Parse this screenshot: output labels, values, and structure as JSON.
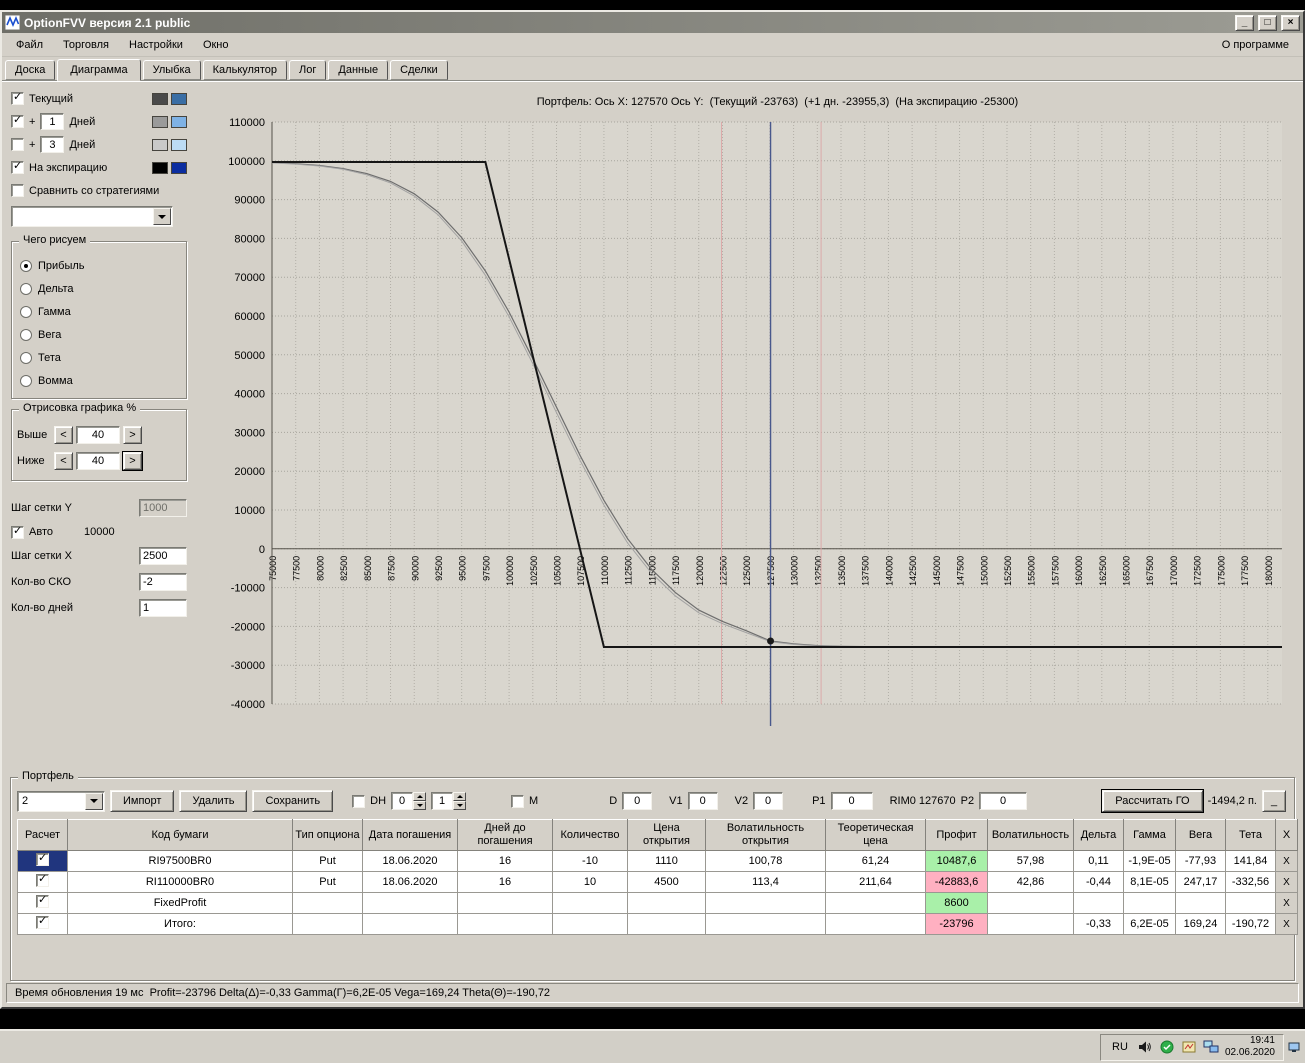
{
  "window": {
    "title": "OptionFVV версия 2.1 public",
    "minimize_glyph": "_",
    "maximize_glyph": "□",
    "close_glyph": "×"
  },
  "menu": {
    "items": [
      "Файл",
      "Торговля",
      "Настройки",
      "Окно"
    ],
    "right_item": "О программе"
  },
  "tabs": {
    "items": [
      "Доска",
      "Диаграмма",
      "Улыбка",
      "Калькулятор",
      "Лог",
      "Данные",
      "Сделки"
    ],
    "active": "Диаграмма"
  },
  "sidebar": {
    "series": [
      {
        "label": "Текущий",
        "checked": true,
        "colors": [
          "#4a4a4a",
          "#3a6ea5"
        ]
      },
      {
        "prefix": "+",
        "days": "1",
        "label": "Дней",
        "checked": true,
        "colors": [
          "#9a9a9a",
          "#7fb2e5"
        ]
      },
      {
        "prefix": "+",
        "days": "3",
        "label": "Дней",
        "checked": false,
        "colors": [
          "#c9c9c9",
          "#bcdcf5"
        ]
      },
      {
        "label": "На экспирацию",
        "checked": true,
        "colors": [
          "#000000",
          "#0b2da0"
        ]
      }
    ],
    "compare_label": "Сравнить со стратегиями",
    "compare_checked": false,
    "strategy_value": "",
    "draw_group": {
      "title": "Чего рисуем",
      "options": [
        "Прибыль",
        "Дельта",
        "Гамма",
        "Вега",
        "Тета",
        "Вомма"
      ],
      "selected": "Прибыль"
    },
    "render_group": {
      "title": "Отрисовка графика %",
      "dec_label": "<",
      "inc_label": ">",
      "rows": [
        {
          "label": "Выше",
          "value": "40",
          "focused": false
        },
        {
          "label": "Ниже",
          "value": "40",
          "focused": true
        }
      ]
    },
    "grid": {
      "step_y_label": "Шаг сетки Y",
      "step_y_value": "1000",
      "auto_label": "Авто",
      "auto_checked": true,
      "auto_value": "10000",
      "step_x_label": "Шаг сетки X",
      "step_x_value": "2500",
      "sko_label": "Кол-во СКО",
      "sko_value": "-2",
      "days_label": "Кол-во дней",
      "days_value": "1"
    }
  },
  "chart_data": {
    "type": "line",
    "title": "Портфель: Ось X: 127570 Ось Y:  (Текущий -23763)  (+1 дн. -23955,3)  (На экспирацию -25300)",
    "x_axis": {
      "min": 75000,
      "max": 181500,
      "tick_min": 75000,
      "tick_max": 180000,
      "tick_step": 2500
    },
    "y_axis": {
      "min": -40000,
      "max": 110000,
      "tick_step": 10000
    },
    "grid": true,
    "series": [
      {
        "id": "current",
        "name": "Текущий",
        "color": "#6e6e6e",
        "width": 1.2,
        "points": [
          [
            75000,
            99500
          ],
          [
            77500,
            99250
          ],
          [
            80000,
            98800
          ],
          [
            82500,
            98000
          ],
          [
            85000,
            96700
          ],
          [
            87500,
            94700
          ],
          [
            90000,
            91500
          ],
          [
            92500,
            86800
          ],
          [
            95000,
            80200
          ],
          [
            97500,
            71600
          ],
          [
            100000,
            61000
          ],
          [
            102500,
            49000
          ],
          [
            105000,
            36500
          ],
          [
            107500,
            24000
          ],
          [
            110000,
            12500
          ],
          [
            112500,
            2600
          ],
          [
            115000,
            -5200
          ],
          [
            117500,
            -11200
          ],
          [
            120000,
            -15800
          ],
          [
            122500,
            -18700
          ],
          [
            125000,
            -21100
          ],
          [
            127570,
            -23763
          ],
          [
            130000,
            -24500
          ],
          [
            132500,
            -24950
          ],
          [
            135000,
            -25130
          ],
          [
            140000,
            -25260
          ],
          [
            145000,
            -25300
          ],
          [
            181500,
            -25300
          ]
        ]
      },
      {
        "id": "plus-1-day",
        "name": "+1 Дней",
        "color": "#a3a3a3",
        "width": 1,
        "points": [
          [
            75000,
            99450
          ],
          [
            77500,
            99150
          ],
          [
            80000,
            98650
          ],
          [
            82500,
            97800
          ],
          [
            85000,
            96400
          ],
          [
            87500,
            94300
          ],
          [
            90000,
            90900
          ],
          [
            92500,
            86100
          ],
          [
            95000,
            79300
          ],
          [
            97500,
            70500
          ],
          [
            100000,
            59800
          ],
          [
            102500,
            47700
          ],
          [
            105000,
            35100
          ],
          [
            107500,
            22700
          ],
          [
            110000,
            11300
          ],
          [
            112500,
            1500
          ],
          [
            115000,
            -6200
          ],
          [
            117500,
            -12100
          ],
          [
            120000,
            -16500
          ],
          [
            122500,
            -19300
          ],
          [
            125000,
            -21600
          ],
          [
            127570,
            -23955
          ],
          [
            130000,
            -24650
          ],
          [
            132500,
            -25050
          ],
          [
            135000,
            -25180
          ],
          [
            140000,
            -25280
          ],
          [
            145000,
            -25300
          ],
          [
            181500,
            -25300
          ]
        ]
      },
      {
        "id": "expiration",
        "name": "На экспирацию",
        "color": "#161616",
        "width": 2,
        "points": [
          [
            75000,
            99700
          ],
          [
            97500,
            99700
          ],
          [
            110000,
            -25300
          ],
          [
            181500,
            -25300
          ]
        ]
      }
    ],
    "vlines": [
      {
        "id": "sd-line-left",
        "x": 122400,
        "color": "#dcaaaa",
        "width": 1,
        "extend": 0
      },
      {
        "id": "sd-line-right",
        "x": 132900,
        "color": "#dcaaaa",
        "width": 1,
        "extend": 0
      },
      {
        "id": "current-price-line",
        "x": 127570,
        "color": "#49588c",
        "width": 1.4,
        "extend": 22
      }
    ],
    "marker": {
      "x": 127570,
      "y": -23763
    }
  },
  "portfolio": {
    "title": "Портфель",
    "toolbar": {
      "combo_value": "2",
      "import_button": "Импорт",
      "delete_button": "Удалить",
      "save_button": "Сохранить",
      "dh_label": "DH",
      "dh_checked": false,
      "dh_spin1": "0",
      "dh_spin2": "1",
      "m_label": "M",
      "m_checked": false,
      "d_label": "D",
      "d_value": "0",
      "v1_label": "V1",
      "v1_value": "0",
      "v2_label": "V2",
      "v2_value": "0",
      "p1_label": "P1",
      "p1_value": "0",
      "rim_label": "RIM0 127670",
      "p2_label": "P2",
      "p2_value": "0",
      "calc_button": "Рассчитать ГО",
      "margin_value": "-1494,2 п.",
      "collapse_button": "_"
    },
    "table": {
      "columns": [
        "Расчет",
        "Код бумаги",
        "Тип опциона",
        "Дата погашения",
        "Дней до погашения",
        "Количество",
        "Цена открытия",
        "Волатильность открытия",
        "Теоретическая цена",
        "Профит",
        "Волатильность",
        "Дельта",
        "Гамма",
        "Вега",
        "Тета",
        "X"
      ],
      "delete_label": "X",
      "rows": [
        {
          "checked": true,
          "selected": true,
          "profit_positive": true,
          "values": [
            "RI97500BR0",
            "Put",
            "18.06.2020",
            "16",
            "-10",
            "1110",
            "100,78",
            "61,24",
            "10487,6",
            "57,98",
            "0,11",
            "-1,9E-05",
            "-77,93",
            "141,84"
          ]
        },
        {
          "checked": true,
          "selected": false,
          "profit_positive": false,
          "values": [
            "RI110000BR0",
            "Put",
            "18.06.2020",
            "16",
            "10",
            "4500",
            "113,4",
            "211,64",
            "-42883,6",
            "42,86",
            "-0,44",
            "8,1E-05",
            "247,17",
            "-332,56"
          ]
        },
        {
          "checked": true,
          "selected": false,
          "profit_positive": true,
          "values": [
            "FixedProfit",
            "",
            "",
            "",
            "",
            "",
            "",
            "",
            "8600",
            "",
            "",
            "",
            "",
            ""
          ]
        },
        {
          "checked": true,
          "selected": false,
          "profit_positive": false,
          "values": [
            "Итого:",
            "",
            "",
            "",
            "",
            "",
            "",
            "",
            "-23796",
            "",
            "-0,33",
            "6,2E-05",
            "169,24",
            "-190,72"
          ]
        }
      ]
    }
  },
  "statusbar": {
    "text": "Время обновления 19 мс  Profit=-23796 Delta(Δ)=-0,33 Gamma(Г)=6,2E-05 Vega=169,24 Theta(Θ)=-190,72"
  },
  "taskbar": {
    "lang": "RU",
    "time": "19:41",
    "date": "02.06.2020"
  }
}
